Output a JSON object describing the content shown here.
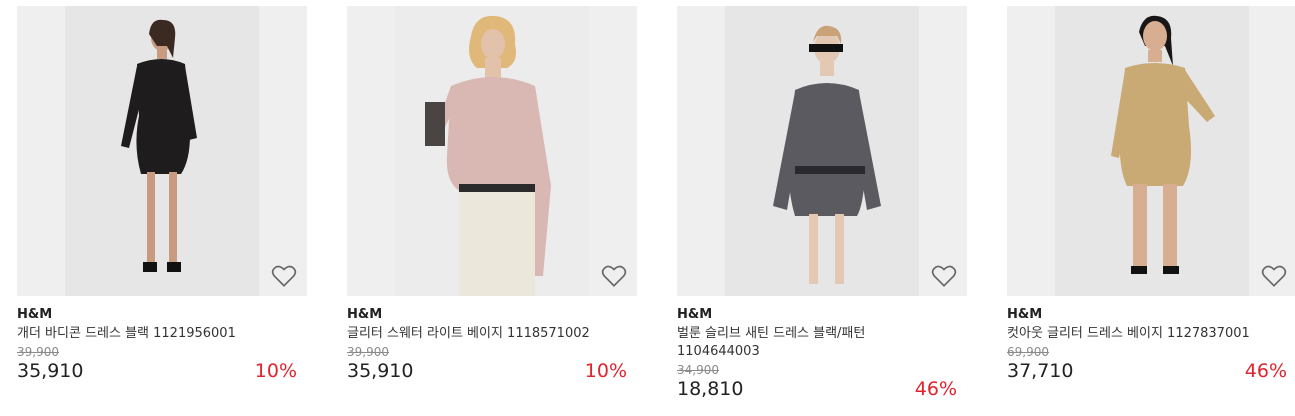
{
  "products": [
    {
      "brand": "H&M",
      "name": "개더 바디콘 드레스 블랙 1121956001",
      "original_price": "39,900",
      "price": "35,910",
      "discount": "10%",
      "dress_color": "#1e1c1c",
      "icon": "heart-outline-icon"
    },
    {
      "brand": "H&M",
      "name": "글리터 스웨터 라이트 베이지 1118571002",
      "original_price": "39,900",
      "price": "35,910",
      "discount": "10%",
      "dress_color": "#d9b8b3",
      "icon": "heart-outline-icon"
    },
    {
      "brand": "H&M",
      "name": "벌룬 슬리브 새틴 드레스 블랙/패턴 1104644003",
      "original_price": "34,900",
      "price": "18,810",
      "discount": "46%",
      "dress_color": "#5a5a60",
      "icon": "heart-outline-icon"
    },
    {
      "brand": "H&M",
      "name": "컷아웃 글리터 드레스 베이지 1127837001",
      "original_price": "69,900",
      "price": "37,710",
      "discount": "46%",
      "dress_color": "#c9aa74",
      "icon": "heart-outline-icon"
    }
  ],
  "colors": {
    "discount": "#e0232e",
    "strike": "#8a8a8a"
  }
}
